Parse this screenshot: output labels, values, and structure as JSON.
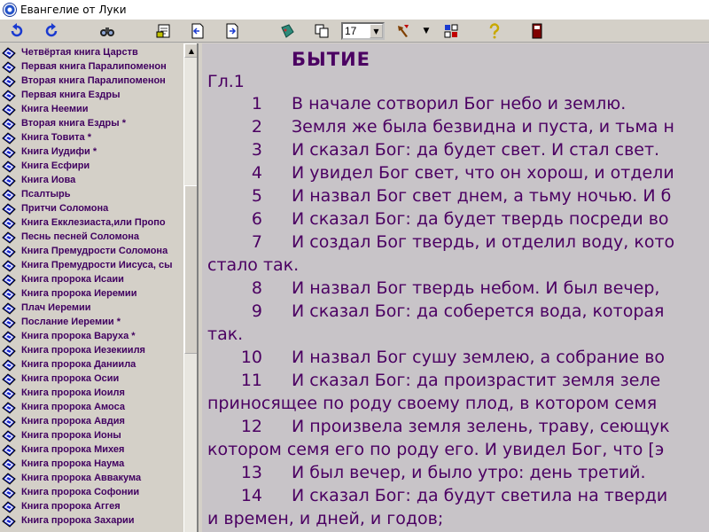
{
  "window": {
    "title": "Евангелие от Луки"
  },
  "toolbar": {
    "zoom_value": "17",
    "buttons": [
      "back-icon",
      "forward-icon",
      "find-icon",
      "print-icon",
      "prev-page-icon",
      "next-page-icon",
      "bookmark-icon",
      "copy-icon",
      "tools-icon",
      "settings-icon",
      "help-icon",
      "exit-icon"
    ]
  },
  "sidebar": {
    "books": [
      "Четвёртая книга Царств",
      "Первая книга Паралипоменон",
      "Вторая книга Паралипоменон",
      "Первая книга Ездры",
      "Книга Неемии",
      "Вторая книга Ездры *",
      "Книга Товита *",
      "Книга Иудифи *",
      "Книга Есфири",
      "Книга Иова",
      "Псалтырь",
      "Притчи Соломона",
      "Книга Екклезиаста,или Пропо",
      "Песнь песней Соломона",
      "Книга Премудрости Соломона",
      "Книга Премудрости Иисуса, сы",
      "Книга пророка Исаии",
      "Книга пророка Иеремии",
      "Плач Иеремии",
      "Послание Иеремии *",
      "Книга пророка Варуха *",
      "Книга пророка Иезекииля",
      "Книга пророка Даниила",
      "Книга пророка Осии",
      "Книга пророка Иоиля",
      "Книга пророка Амоса",
      "Книга пророка Авдия",
      "Книга пророка Ионы",
      "Книга пророка Михея",
      "Книга пророка Наума",
      "Книга пророка Аввакума",
      "Книга пророка Софонии",
      "Книга пророка Аггея",
      "Книга пророка Захарии"
    ]
  },
  "reader": {
    "book_title": "БЫТИЕ",
    "chapter": "Гл.1",
    "lines": [
      {
        "num": "1",
        "text": "В начале сотворил Бог небо и землю."
      },
      {
        "num": "2",
        "text": "Земля же была безвидна и пуста, и тьма н"
      },
      {
        "num": "3",
        "text": "И сказал Бог: да будет свет. И стал свет."
      },
      {
        "num": "4",
        "text": "И увидел Бог свет, что он хорош, и отдели"
      },
      {
        "num": "5",
        "text": "И назвал Бог свет днем, а тьму ночью. И б"
      },
      {
        "num": "6",
        "text": "И сказал Бог: да будет твердь посреди во"
      },
      {
        "num": "7",
        "text": "И создал Бог твердь, и отделил воду, кото"
      },
      {
        "num": "",
        "text": "стало так."
      },
      {
        "num": "8",
        "text": "И назвал Бог твердь небом. И был вечер,"
      },
      {
        "num": "9",
        "text": "И сказал Бог: да соберется вода, которая"
      },
      {
        "num": "",
        "text": "так."
      },
      {
        "num": "10",
        "text": "И назвал Бог сушу землею, а собрание во"
      },
      {
        "num": "11",
        "text": "И сказал Бог: да произрастит земля зеле"
      },
      {
        "num": "",
        "text": "приносящее по роду своему плод, в котором семя"
      },
      {
        "num": "12",
        "text": "И произвела земля зелень, траву, сеющук"
      },
      {
        "num": "",
        "text": "котором семя его по роду его. И увидел Бог, что [э"
      },
      {
        "num": "13",
        "text": "И был вечер, и было утро: день третий."
      },
      {
        "num": "14",
        "text": "И сказал Бог: да будут светила на тверди"
      },
      {
        "num": "",
        "text": "и времен, и дней, и годов;"
      }
    ]
  }
}
